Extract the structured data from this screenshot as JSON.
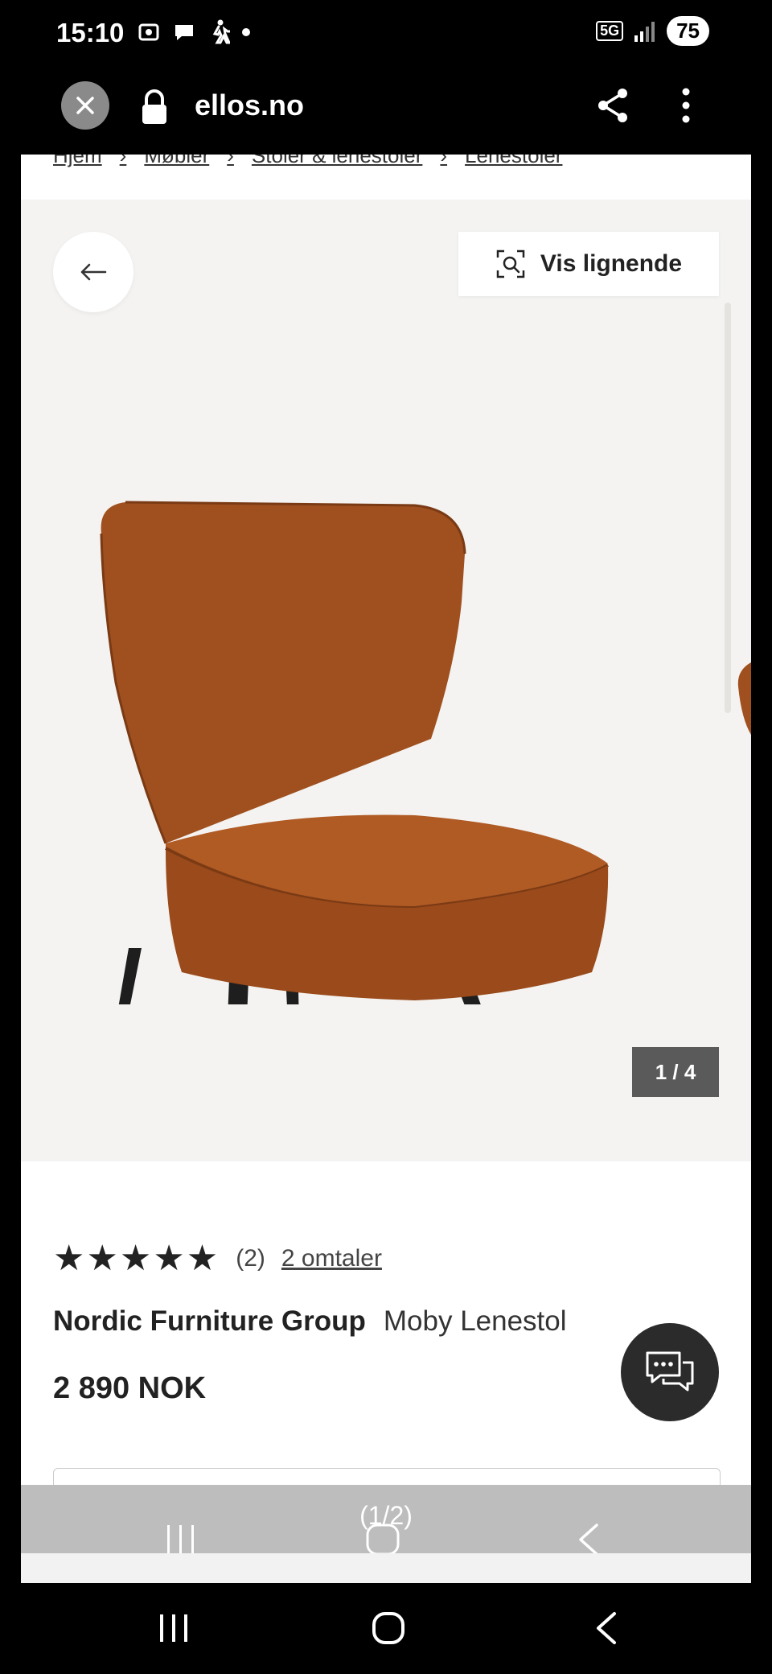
{
  "status": {
    "time": "15:10",
    "network": "5G",
    "battery": "75"
  },
  "browser": {
    "url": "ellos.no"
  },
  "breadcrumb": [
    "Hjem",
    "Møbler",
    "Stoler & lenestoler",
    "Lenestoler"
  ],
  "gallery": {
    "similar_label": "Vis lignende",
    "counter": "1 / 4",
    "current": 1,
    "total": 4
  },
  "product": {
    "rating": 5,
    "stars": "★★★★★",
    "rating_count": "(2)",
    "reviews_link": "2 omtaler",
    "brand": "Nordic Furniture Group",
    "name": "Moby Lenestol",
    "price": "2 890 NOK"
  },
  "overlay": {
    "page_indicator": "(1/2)"
  },
  "icons": {
    "close": "close-icon",
    "lock": "lock-icon",
    "share": "share-icon",
    "more": "more-vert-icon",
    "back": "arrow-left-icon",
    "similar": "visual-search-icon",
    "chat": "chat-icon",
    "recents": "recents-icon",
    "home": "home-icon",
    "nav_back": "back-icon"
  },
  "colors": {
    "chair": "#a0501f",
    "legs": "#1e1e1e",
    "gallery_bg": "#f4f3f1",
    "chat_bg": "#2b2b2b"
  }
}
